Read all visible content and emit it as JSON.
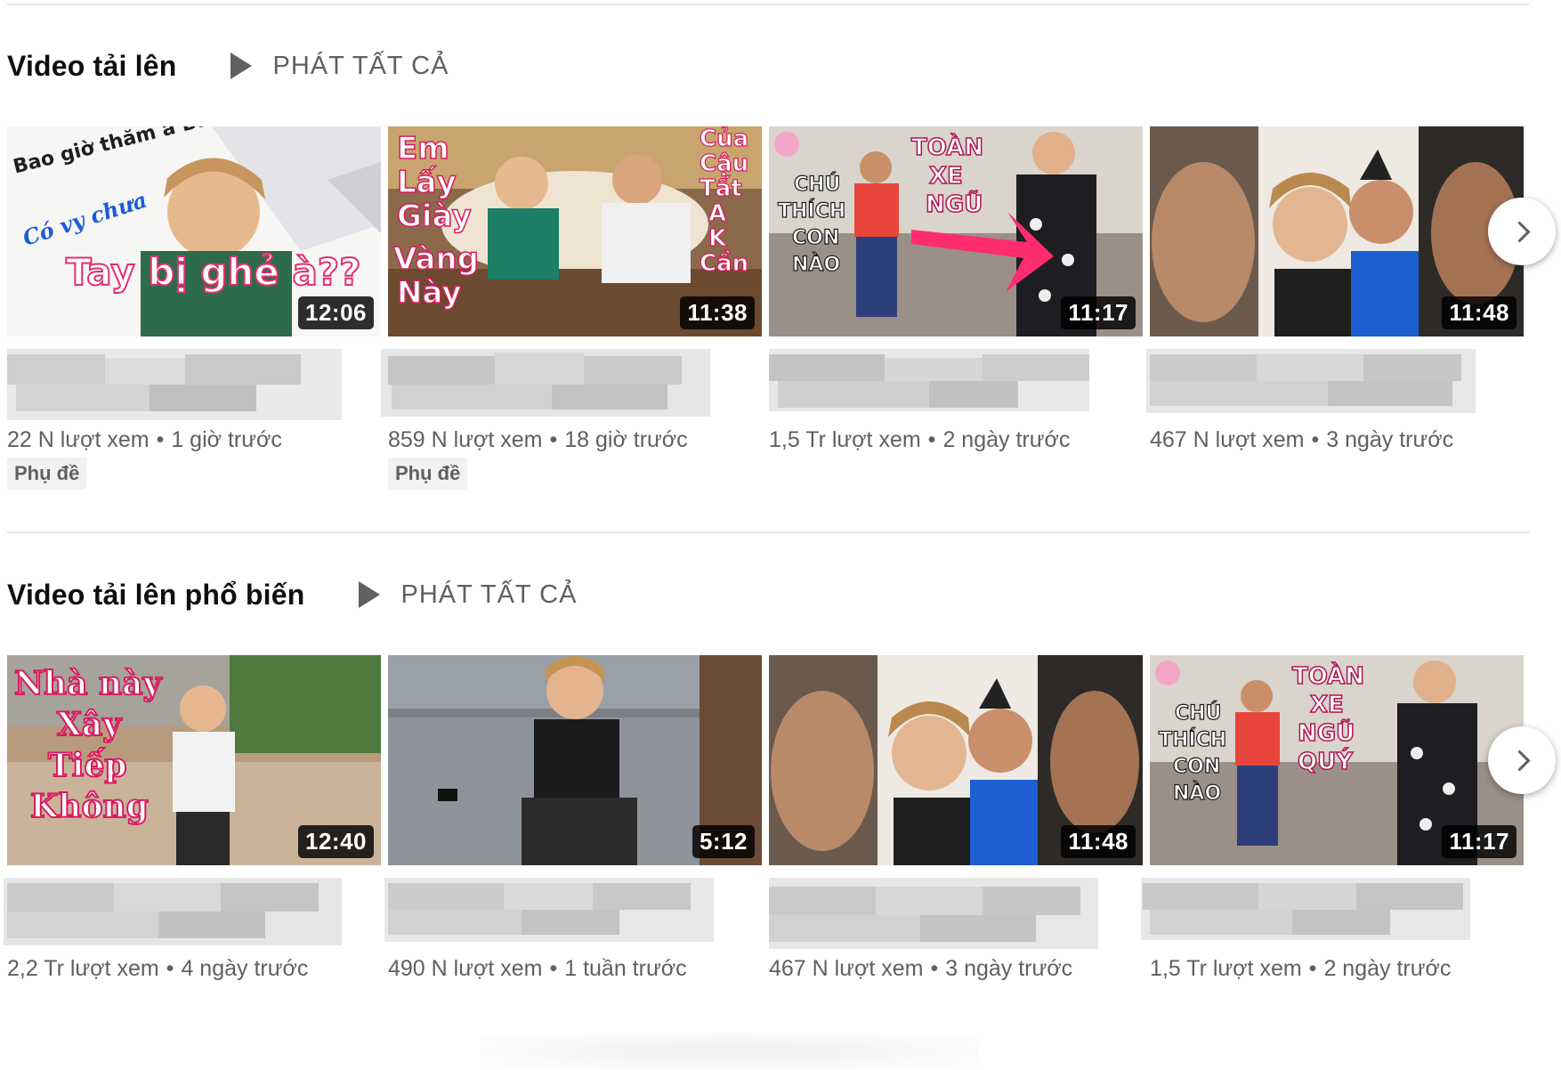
{
  "shelves": [
    {
      "title": "Video tải lên",
      "play_all": "PHÁT TẤT CẢ",
      "videos": [
        {
          "duration": "12:06",
          "views": "22 N lượt xem",
          "age": "1 giờ trước",
          "badge": "Phụ đề",
          "thumb_text": [
            "Bao giờ thăm a Bảnh?",
            "Có vy chưa",
            "Tay bị ghẻ à??"
          ]
        },
        {
          "duration": "11:38",
          "views": "859 N lượt xem",
          "age": "18 giờ trước",
          "badge": "Phụ đề",
          "thumb_text": [
            "Em Lấy Giày Vàng Này",
            "Của Cậu Tất A K Cần"
          ]
        },
        {
          "duration": "11:17",
          "views": "1,5 Tr lượt xem",
          "age": "2 ngày trước",
          "thumb_text": [
            "TOÀN XE NGŨ",
            "CHÚ THÍCH CON NÀO"
          ]
        },
        {
          "duration": "11:48",
          "views": "467 N lượt xem",
          "age": "3 ngày trước"
        }
      ]
    },
    {
      "title": "Video tải lên phổ biến",
      "play_all": "PHÁT TẤT CẢ",
      "videos": [
        {
          "duration": "12:40",
          "views": "2,2 Tr lượt xem",
          "age": "4 ngày trước",
          "thumb_text": [
            "Nhà này",
            "Xây",
            "Tiếp",
            "Không"
          ]
        },
        {
          "duration": "5:12",
          "views": "490 N lượt xem",
          "age": "1 tuần trước"
        },
        {
          "duration": "11:48",
          "views": "467 N lượt xem",
          "age": "3 ngày trước"
        },
        {
          "duration": "11:17",
          "views": "1,5 Tr lượt xem",
          "age": "2 ngày trước",
          "thumb_text": [
            "TOÀN XE NGŨ QUÝ",
            "CHÚ THÍCH CON NÀO"
          ]
        }
      ]
    }
  ],
  "icons": {
    "play_all": "play-icon",
    "next": "chevron-right-icon"
  },
  "colors": {
    "meta_text": "#606060",
    "duration_bg": "#000000",
    "badge_bg": "#f2f2f2",
    "arrow_pink": "#ff2d6f"
  }
}
